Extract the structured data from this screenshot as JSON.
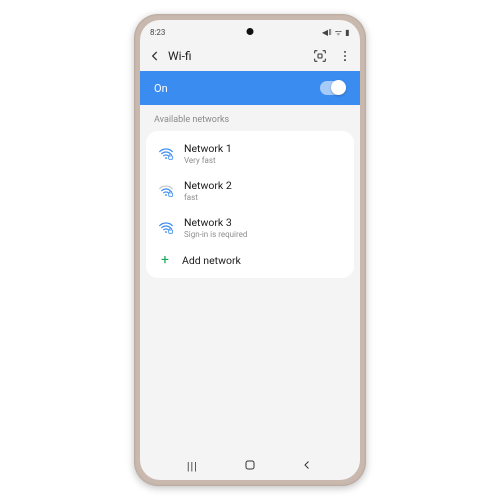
{
  "status": {
    "time": "8:23",
    "indicators": "◀‖ ᯤ ▮"
  },
  "header": {
    "title": "Wi-fi"
  },
  "wifi": {
    "state_label": "On",
    "section_label": "Available networks",
    "networks": [
      {
        "name": "Network 1",
        "sub": "Very fast"
      },
      {
        "name": "Network 2",
        "sub": "fast"
      },
      {
        "name": "Network 3",
        "sub": "Sign-in is required"
      }
    ],
    "add_label": "Add network"
  },
  "colors": {
    "accent": "#3b8cf0"
  }
}
